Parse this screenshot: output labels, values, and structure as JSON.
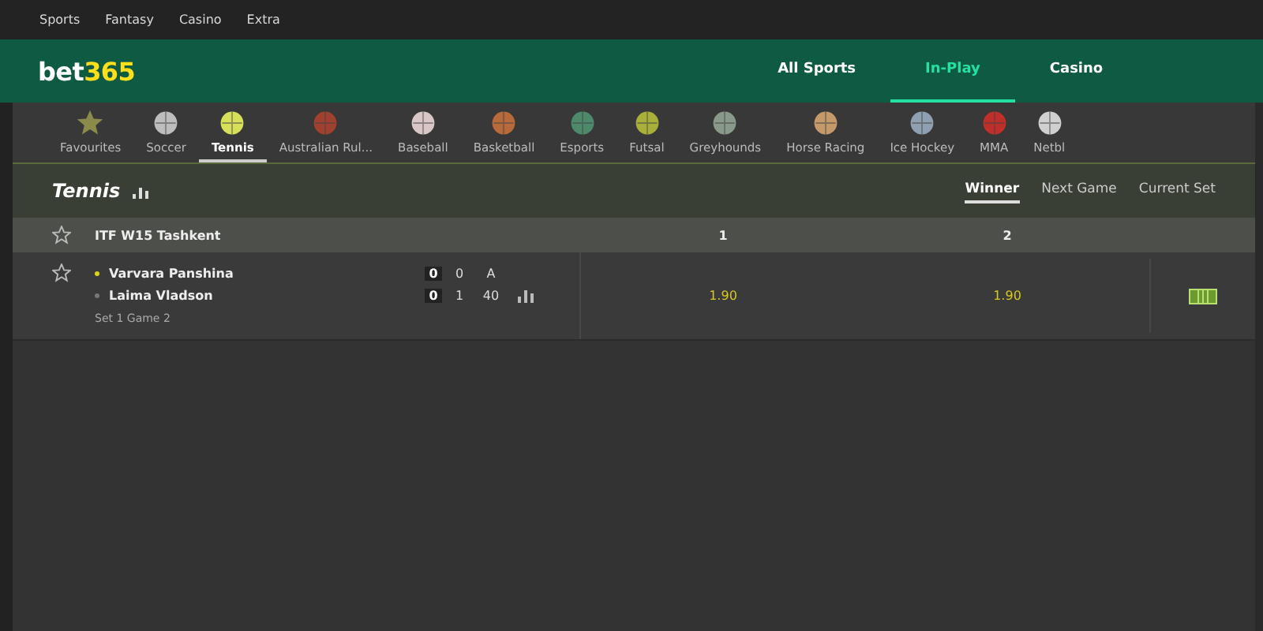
{
  "top_links": [
    "Sports",
    "Fantasy",
    "Casino",
    "Extra"
  ],
  "brand": {
    "first": "bet",
    "second": "365"
  },
  "main_nav": [
    {
      "label": "All Sports",
      "selected": false
    },
    {
      "label": "In-Play",
      "selected": true
    },
    {
      "label": "Casino",
      "selected": false
    }
  ],
  "sports": [
    {
      "label": "Favourites",
      "selected": false
    },
    {
      "label": "Soccer",
      "selected": false
    },
    {
      "label": "Tennis",
      "selected": true
    },
    {
      "label": "Australian Rul...",
      "selected": false
    },
    {
      "label": "Baseball",
      "selected": false
    },
    {
      "label": "Basketball",
      "selected": false
    },
    {
      "label": "Esports",
      "selected": false
    },
    {
      "label": "Futsal",
      "selected": false
    },
    {
      "label": "Greyhounds",
      "selected": false
    },
    {
      "label": "Horse Racing",
      "selected": false
    },
    {
      "label": "Ice Hockey",
      "selected": false
    },
    {
      "label": "MMA",
      "selected": false
    },
    {
      "label": "Netbl",
      "selected": false
    }
  ],
  "section": {
    "title": "Tennis",
    "market_tabs": [
      {
        "label": "Winner",
        "selected": true
      },
      {
        "label": "Next Game",
        "selected": false
      },
      {
        "label": "Current Set",
        "selected": false
      }
    ]
  },
  "competition": {
    "name": "ITF W15 Tashkent",
    "columns": [
      "1",
      "2"
    ]
  },
  "match": {
    "players": [
      {
        "name": "Varvara Panshina",
        "serving": true,
        "sets": "0",
        "games": "0",
        "points": "A"
      },
      {
        "name": "Laima Vladson",
        "serving": false,
        "sets": "0",
        "games": "1",
        "points": "40"
      }
    ],
    "status": "Set 1 Game 2",
    "odds": [
      "1.90",
      "1.90"
    ]
  }
}
